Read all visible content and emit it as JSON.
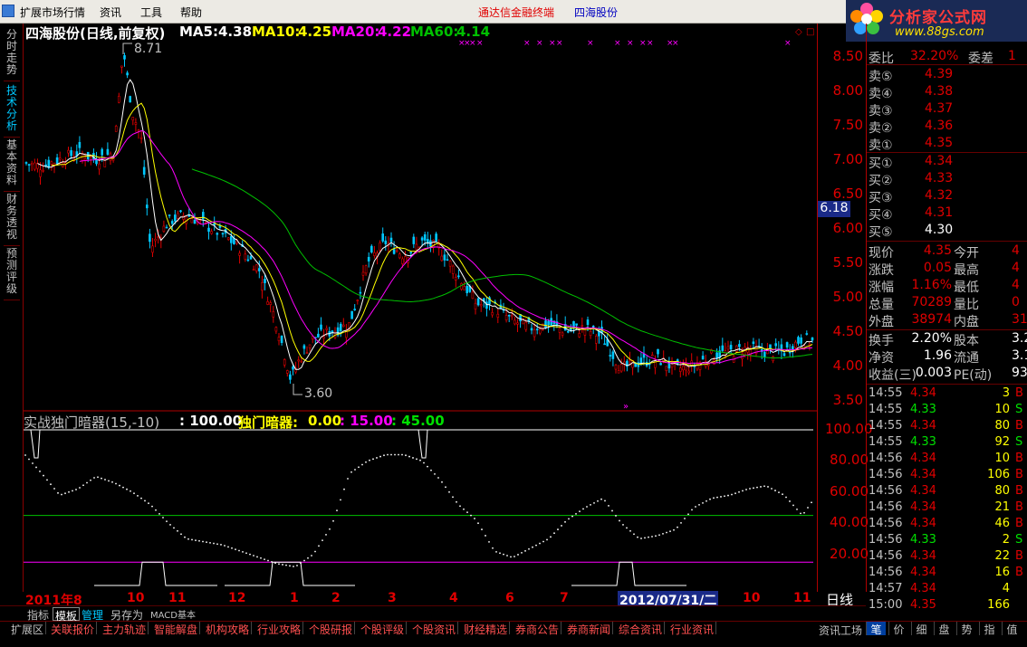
{
  "menu": {
    "items": [
      "扩展市场行情",
      "资讯",
      "工具",
      "帮助"
    ],
    "broker": "通达信金融终端",
    "stock": "四海股份"
  },
  "logo": {
    "title": "分析家公式网",
    "url": "www.88gs.com"
  },
  "left_tabs": [
    {
      "label": "分时走势",
      "active": false
    },
    {
      "label": "技术分析",
      "active": true
    },
    {
      "label": "基本资料",
      "active": false
    },
    {
      "label": "财务透视",
      "active": false
    },
    {
      "label": "预测评级",
      "active": false
    }
  ],
  "main_chart": {
    "title": "四海股份(日线,前复权)",
    "ma5_label": "MA5:",
    "ma5": "4.38",
    "ma10_label": "MA10:",
    "ma10": "4.25",
    "ma20_label": "MA20:",
    "ma20": "4.22",
    "ma60_label": "MA60:",
    "ma60": "4.14",
    "high_label": "8.71",
    "low_label": "3.60"
  },
  "main_axis": [
    "8.50",
    "8.00",
    "7.50",
    "7.00",
    "6.50",
    "6.00",
    "5.50",
    "5.00",
    "4.50",
    "4.00",
    "3.50"
  ],
  "current_price_box": "6.18",
  "indicator": {
    "title": "实战独门暗器(15,-10)",
    "val1": ": 100.00",
    "name2": "独门暗器:",
    "val2": "0.00",
    "val3": ": 15.00",
    "val4": ": 45.00"
  },
  "ind_axis": [
    "100.00",
    "80.00",
    "60.00",
    "40.00",
    "20.00"
  ],
  "date_axis": {
    "start": "2011年8",
    "ticks": [
      "10",
      "11",
      "12",
      "1",
      "2",
      "3",
      "4",
      "6",
      "7",
      "10",
      "11"
    ],
    "highlight": "2012/07/31/二",
    "period": "日线"
  },
  "quote": {
    "weibi_label": "委比",
    "weibi": "32.20%",
    "weicha_label": "委差",
    "weicha": "1",
    "sells": [
      {
        "label": "卖⑤",
        "price": "4.39"
      },
      {
        "label": "卖④",
        "price": "4.38"
      },
      {
        "label": "卖③",
        "price": "4.37"
      },
      {
        "label": "卖②",
        "price": "4.36"
      },
      {
        "label": "卖①",
        "price": "4.35"
      }
    ],
    "buys": [
      {
        "label": "买①",
        "price": "4.34"
      },
      {
        "label": "买②",
        "price": "4.33"
      },
      {
        "label": "买③",
        "price": "4.32"
      },
      {
        "label": "买④",
        "price": "4.31"
      },
      {
        "label": "买⑤",
        "price": "4.30"
      }
    ],
    "stats": [
      {
        "l1": "现价",
        "v1": "4.35",
        "l2": "今开",
        "v2": "4"
      },
      {
        "l1": "涨跌",
        "v1": "0.05",
        "l2": "最高",
        "v2": "4"
      },
      {
        "l1": "涨幅",
        "v1": "1.16%",
        "l2": "最低",
        "v2": "4"
      },
      {
        "l1": "总量",
        "v1": "70289",
        "l2": "量比",
        "v2": "0"
      },
      {
        "l1": "外盘",
        "v1": "38974",
        "l2": "内盘",
        "v2": "31"
      }
    ],
    "stats2": [
      {
        "l1": "换手",
        "v1": "2.20%",
        "l2": "股本",
        "v2": "3.2"
      },
      {
        "l1": "净资",
        "v1": "1.96",
        "l2": "流通",
        "v2": "3.1"
      },
      {
        "l1": "收益(三)",
        "v1": "0.003",
        "l2": "PE(动)",
        "v2": "93"
      }
    ]
  },
  "ticks": [
    {
      "t": "14:55",
      "p": "4.34",
      "v": "3",
      "s": "B"
    },
    {
      "t": "14:55",
      "p": "4.33",
      "v": "10",
      "s": "S"
    },
    {
      "t": "14:55",
      "p": "4.34",
      "v": "80",
      "s": "B"
    },
    {
      "t": "14:55",
      "p": "4.33",
      "v": "92",
      "s": "S"
    },
    {
      "t": "14:56",
      "p": "4.34",
      "v": "10",
      "s": "B"
    },
    {
      "t": "14:56",
      "p": "4.34",
      "v": "106",
      "s": "B"
    },
    {
      "t": "14:56",
      "p": "4.34",
      "v": "80",
      "s": "B"
    },
    {
      "t": "14:56",
      "p": "4.34",
      "v": "21",
      "s": "B"
    },
    {
      "t": "14:56",
      "p": "4.34",
      "v": "46",
      "s": "B"
    },
    {
      "t": "14:56",
      "p": "4.33",
      "v": "2",
      "s": "S"
    },
    {
      "t": "14:56",
      "p": "4.34",
      "v": "22",
      "s": "B"
    },
    {
      "t": "14:56",
      "p": "4.34",
      "v": "16",
      "s": "B"
    },
    {
      "t": "14:57",
      "p": "4.34",
      "v": "4",
      "s": ""
    },
    {
      "t": "15:00",
      "p": "4.35",
      "v": "166",
      "s": ""
    }
  ],
  "bottom_tabs1": [
    "指标",
    "模板",
    "管理",
    "另存为",
    "MACD基本"
  ],
  "bottom_tabs2": [
    "扩展区",
    "关联报价",
    "主力轨迹",
    "智能解盘",
    "机构攻略",
    "行业攻略",
    "个股研报",
    "个股评级",
    "个股资讯",
    "财经精选",
    "券商公告",
    "券商新闻",
    "综合资讯",
    "行业资讯"
  ],
  "bottom_right": {
    "label": "资讯工场",
    "icons": [
      "笔",
      "价",
      "细",
      "盘",
      "势",
      "指",
      "值"
    ]
  },
  "colors": {
    "up": "#e00000",
    "down": "#00c8ff",
    "ma5": "#ffffff",
    "ma10": "#ffff00",
    "ma20": "#ff00ff",
    "ma60": "#00c000"
  }
}
